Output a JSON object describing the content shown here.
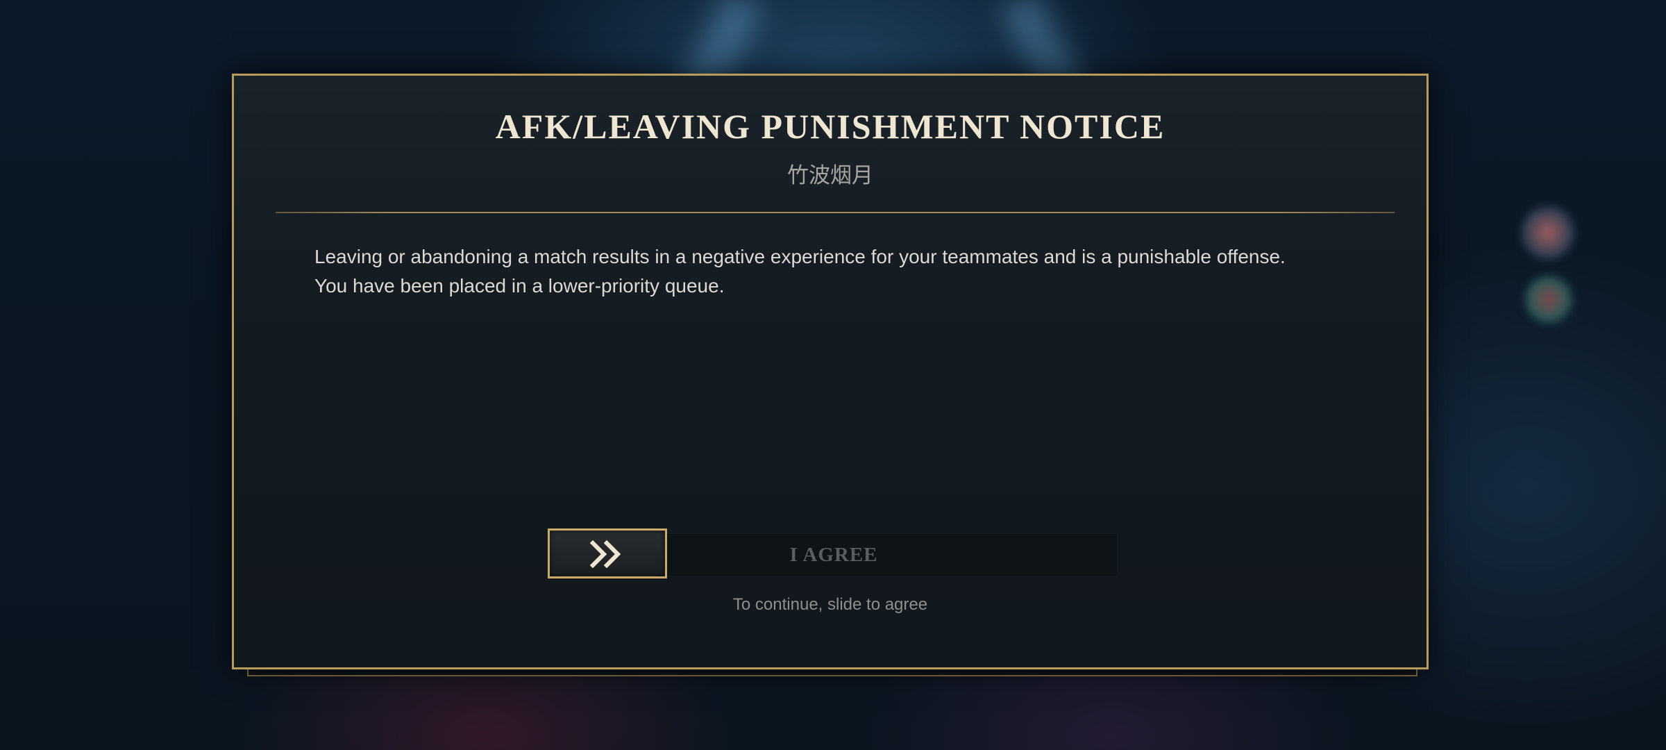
{
  "dialog": {
    "title": "AFK/LEAVING PUNISHMENT NOTICE",
    "player_name": "竹波烟月",
    "message": "Leaving or abandoning a match results in a negative experience for your teammates and is a punishable offense. You have been placed in a lower-priority queue."
  },
  "slider": {
    "label": "I AGREE",
    "handle_icon": "double-chevron-right-icon",
    "hint": "To continue, slide to agree",
    "progress": 0
  },
  "colors": {
    "accent_gold": "#b89b5d",
    "panel_bg": "#131a20",
    "title_text": "#efe6d2"
  }
}
